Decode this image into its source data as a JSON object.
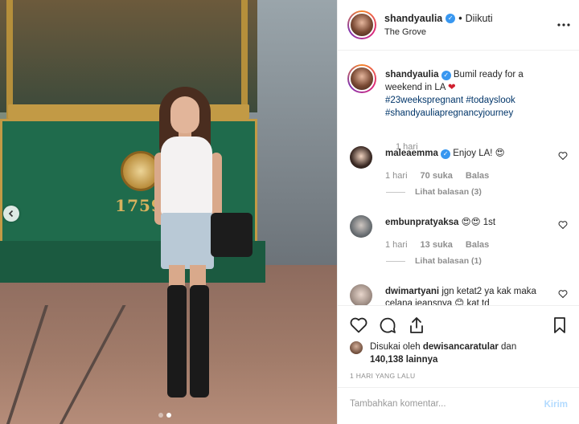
{
  "post": {
    "username": "shandyaulia",
    "follow_status": "Diikuti",
    "location": "The Grove",
    "more_icon": "more-horizontal-icon"
  },
  "photo": {
    "tram_number": "1759",
    "carousel_prev_icon": "chevron-left-icon",
    "carousel_total": 2,
    "carousel_active": 2
  },
  "caption": {
    "username": "shandyaulia",
    "text": "Bumil ready for a weekend in LA",
    "emoji": "❤",
    "hashtags": [
      "#23weekspregnant",
      "#todayslook",
      "#shandyauliapregnancyjourney"
    ],
    "time": "1 hari"
  },
  "comments": [
    {
      "username": "maleaemma",
      "text": "Enjoy LA! 😍",
      "time": "1 hari",
      "likes": "70 suka",
      "reply": "Balas",
      "view_replies": "Lihat balasan (3)"
    },
    {
      "username": "embunpratyaksa",
      "text": "😍😍 1st",
      "time": "1 hari",
      "likes": "13 suka",
      "reply": "Balas",
      "view_replies": "Lihat balasan (1)"
    },
    {
      "username": "dwimartyani",
      "text": "jgn ketat2 ya kak maka celana jeansnya 😊 kat td"
    }
  ],
  "likes": {
    "prefix": "Disukai oleh",
    "user": "dewisancaratular",
    "and": "dan",
    "others": "140,138 lainnya"
  },
  "posted": "1 HARI YANG LALU",
  "add_comment": {
    "placeholder": "Tambahkan komentar...",
    "send_label": "Kirim"
  },
  "colors": {
    "link": "#003569",
    "muted": "#8e8e8e",
    "verified": "#3897f0",
    "send_disabled": "#b3dbff",
    "tram_green": "#1f6b4c"
  }
}
